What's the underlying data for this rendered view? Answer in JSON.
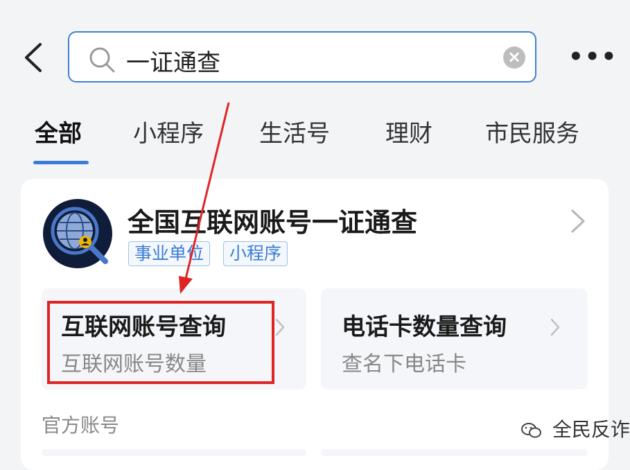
{
  "search": {
    "value": "一证通查"
  },
  "tabs": [
    {
      "label": "全部",
      "active": true
    },
    {
      "label": "小程序"
    },
    {
      "label": "生活号"
    },
    {
      "label": "理财"
    },
    {
      "label": "市民服务"
    }
  ],
  "result": {
    "title": "全国互联网账号一证通查",
    "tags": [
      "事业单位",
      "小程序"
    ],
    "services": [
      {
        "title": "互联网账号查询",
        "desc": "互联网账号数量"
      },
      {
        "title": "电话卡数量查询",
        "desc": "查名下电话卡"
      }
    ],
    "section_label": "官方账号"
  },
  "watermark": "全民反诈",
  "colors": {
    "accent": "#3a7bd5",
    "highlight": "#e02424"
  },
  "icons": [
    "back-arrow-icon",
    "search-icon",
    "clear-icon",
    "more-icon",
    "globe-search-logo-icon",
    "chevron-right-icon",
    "wechat-icon"
  ]
}
